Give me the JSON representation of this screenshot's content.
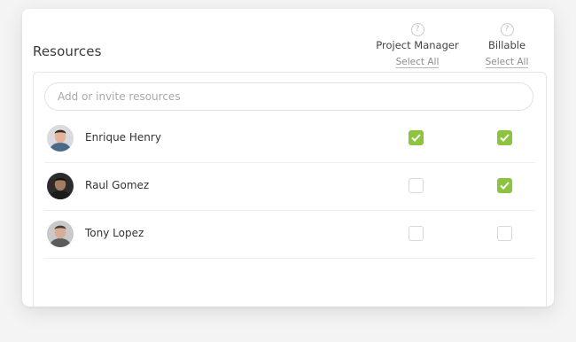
{
  "header": {
    "title": "Resources",
    "columns": [
      {
        "label": "Project Manager",
        "select_all": "Select All",
        "help_icon": "?"
      },
      {
        "label": "Billable",
        "select_all": "Select All",
        "help_icon": "?"
      }
    ]
  },
  "search": {
    "placeholder": "Add or invite resources",
    "value": ""
  },
  "rows": [
    {
      "name": "Enrique Henry",
      "project_manager": true,
      "billable": true
    },
    {
      "name": "Raul Gomez",
      "project_manager": false,
      "billable": true
    },
    {
      "name": "Tony Lopez",
      "project_manager": false,
      "billable": false
    }
  ],
  "colors": {
    "checked": "#8cc43f",
    "unchecked_border": "#d7d7d7"
  }
}
